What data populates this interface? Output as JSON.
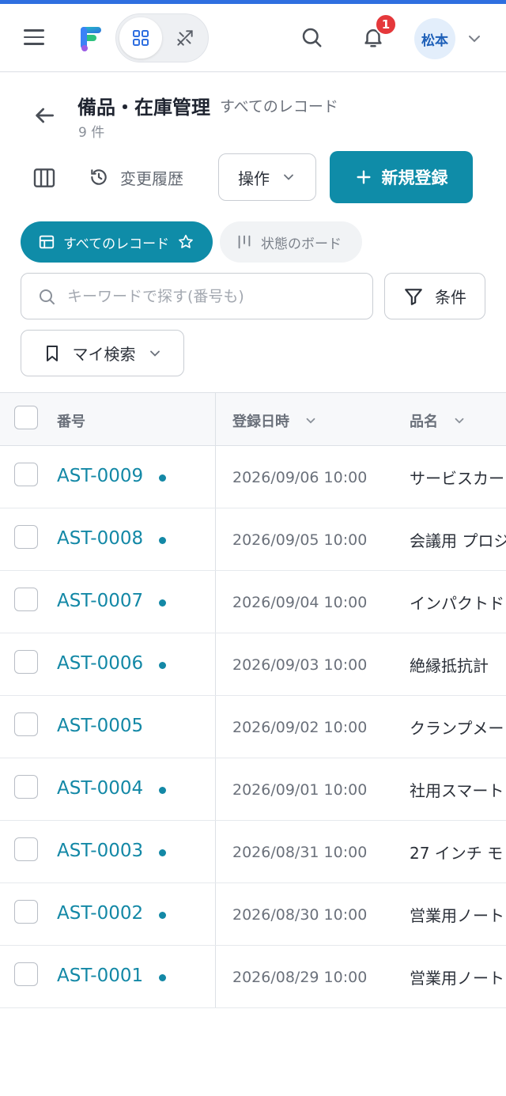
{
  "header": {
    "avatar_text": "松本",
    "notification_count": "1"
  },
  "page": {
    "title": "備品・在庫管理",
    "view_name": "すべてのレコード",
    "record_count": "9 件"
  },
  "toolbar": {
    "history_label": "変更履歴",
    "operations_label": "操作",
    "new_label": "新規登録"
  },
  "views": {
    "all_label": "すべてのレコード",
    "board_label": "状態のボード"
  },
  "search": {
    "placeholder": "キーワードで探す(番号も)",
    "conditions_label": "条件",
    "my_search_label": "マイ検索"
  },
  "table": {
    "columns": [
      "番号",
      "登録日時",
      "品名"
    ],
    "rows": [
      {
        "id": "AST-0009",
        "date": "2026/09/06 10:00",
        "name": "サービスカー",
        "dot": true
      },
      {
        "id": "AST-0008",
        "date": "2026/09/05 10:00",
        "name": "会議用 プロジ",
        "dot": true
      },
      {
        "id": "AST-0007",
        "date": "2026/09/04 10:00",
        "name": "インパクトド",
        "dot": true
      },
      {
        "id": "AST-0006",
        "date": "2026/09/03 10:00",
        "name": "絶縁抵抗計",
        "dot": true
      },
      {
        "id": "AST-0005",
        "date": "2026/09/02 10:00",
        "name": "クランプメー",
        "dot": false
      },
      {
        "id": "AST-0004",
        "date": "2026/09/01 10:00",
        "name": "社用スマート",
        "dot": true
      },
      {
        "id": "AST-0003",
        "date": "2026/08/31 10:00",
        "name": "27 インチ モ",
        "dot": true
      },
      {
        "id": "AST-0002",
        "date": "2026/08/30 10:00",
        "name": "営業用ノート",
        "dot": true
      },
      {
        "id": "AST-0001",
        "date": "2026/08/29 10:00",
        "name": "営業用ノート",
        "dot": true
      }
    ]
  },
  "colors": {
    "accent": "#0f8ca8",
    "link": "#1388a6",
    "badge": "#e5383b",
    "top_stripe": "#2f6fe0"
  },
  "icons": [
    "menu-icon",
    "app-logo",
    "grid-icon",
    "tools-icon",
    "search-icon",
    "bell-icon",
    "chevron-down-icon",
    "arrow-left-icon",
    "columns-icon",
    "history-icon",
    "plus-icon",
    "table-icon",
    "star-icon",
    "board-icon",
    "filter-icon",
    "bookmark-icon"
  ]
}
